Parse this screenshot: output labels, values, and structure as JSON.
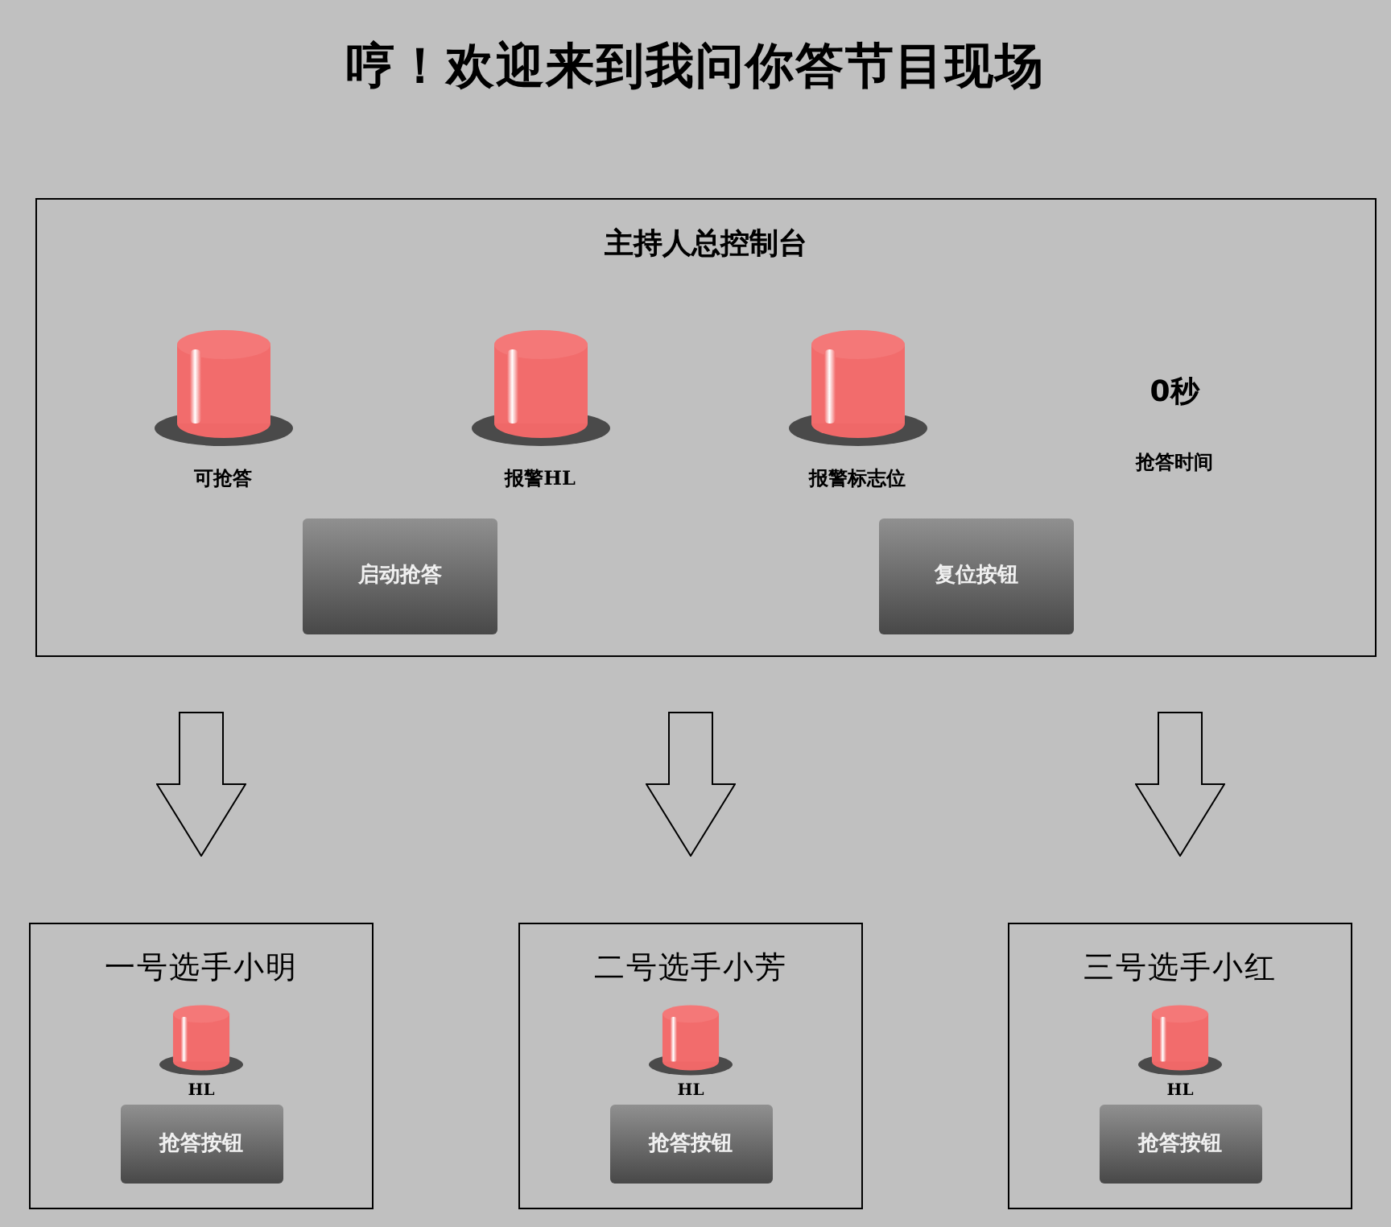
{
  "title": "哼！欢迎来到我问你答节目现场",
  "host_panel": {
    "title": "主持人总控制台",
    "lamps": [
      {
        "label": "可抢答"
      },
      {
        "label": "报警HL"
      },
      {
        "label": "报警标志位"
      }
    ],
    "timer": {
      "value": "0秒",
      "label": "抢答时间"
    },
    "buttons": [
      "启动抢答",
      "复位按钮"
    ]
  },
  "contestants": [
    {
      "title": "一号选手小明",
      "lamp_label": "HL",
      "button": "抢答按钮"
    },
    {
      "title": "二号选手小芳",
      "lamp_label": "HL",
      "button": "抢答按钮"
    },
    {
      "title": "三号选手小红",
      "lamp_label": "HL",
      "button": "抢答按钮"
    }
  ]
}
